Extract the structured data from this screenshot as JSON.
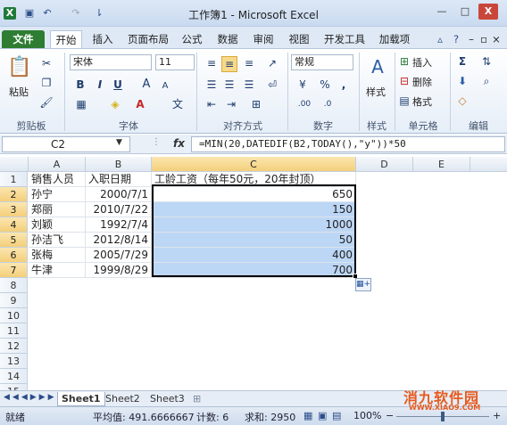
{
  "window": {
    "title": "工作簿1 - Microsoft Excel",
    "minimize": "—",
    "maximize": "□",
    "close": "X"
  },
  "quick_access": {
    "save_icon": "save-icon",
    "undo_icon": "undo-icon",
    "redo_icon": "redo-icon"
  },
  "tabs": [
    "文件",
    "开始",
    "插入",
    "页面布局",
    "公式",
    "数据",
    "审阅",
    "视图",
    "开发工具",
    "加载项"
  ],
  "ribbon": {
    "clipboard": {
      "label": "剪贴板",
      "paste": "粘贴"
    },
    "font": {
      "label": "字体",
      "name": "宋体",
      "size": "11",
      "bold": "B",
      "italic": "I",
      "underline": "U",
      "grow": "A",
      "shrink": "A"
    },
    "alignment": {
      "label": "对齐方式"
    },
    "number": {
      "label": "数字",
      "format": "常规",
      "percent": "%",
      "comma": ","
    },
    "styles": {
      "label": "样式",
      "button": "样式"
    },
    "cells": {
      "label": "单元格",
      "insert": "插入",
      "delete": "删除",
      "format": "格式"
    },
    "editing": {
      "label": "编辑"
    }
  },
  "formula_bar": {
    "name_box": "C2",
    "fx": "fx",
    "formula": "=MIN(20,DATEDIF(B2,TODAY(),\"y\"))*50"
  },
  "sheet": {
    "columns": [
      "A",
      "B",
      "C",
      "D",
      "E"
    ],
    "rows": [
      "1",
      "2",
      "3",
      "4",
      "5",
      "6",
      "7",
      "8",
      "9",
      "10",
      "11",
      "12",
      "13",
      "14",
      "15"
    ],
    "header_row": {
      "a": "销售人员",
      "b": "入职日期",
      "c": "工龄工资（每年50元，20年封顶）"
    },
    "data": [
      {
        "a": "孙宁",
        "b": "2000/7/1",
        "c": "650"
      },
      {
        "a": "郑丽",
        "b": "2010/7/22",
        "c": "150"
      },
      {
        "a": "刘颖",
        "b": "1992/7/4",
        "c": "1000"
      },
      {
        "a": "孙洁飞",
        "b": "2012/8/14",
        "c": "50"
      },
      {
        "a": "张梅",
        "b": "2005/7/29",
        "c": "400"
      },
      {
        "a": "牛津",
        "b": "1999/8/29",
        "c": "700"
      }
    ]
  },
  "sheet_tabs": [
    "Sheet1",
    "Sheet2",
    "Sheet3"
  ],
  "status": {
    "mode": "就绪",
    "average": "平均值: 491.6666667",
    "count": "计数: 6",
    "sum": "求和: 2950",
    "zoom": "100%",
    "zoom_minus": "−",
    "zoom_plus": "+"
  },
  "watermark": {
    "logo": "消九软件园",
    "sub": "WWW.XIAO9.COM"
  }
}
